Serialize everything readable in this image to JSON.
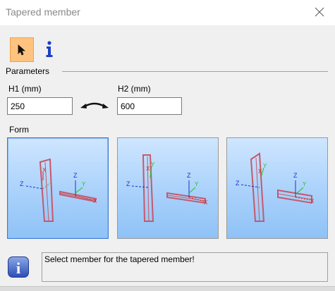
{
  "window": {
    "title": "Tapered member"
  },
  "toolbar": {
    "select_icon": "cursor-arrow-icon",
    "info_icon": "info-icon"
  },
  "parameters": {
    "group_label": "Parameters",
    "h1": {
      "label": "H1 (mm)",
      "value": "250"
    },
    "h2": {
      "label": "H2 (mm)",
      "value": "600"
    },
    "swap_icon": "swap-arrow-icon"
  },
  "form": {
    "label": "Form",
    "options": [
      {
        "name": "form-option-1",
        "selected": true
      },
      {
        "name": "form-option-2",
        "selected": false
      },
      {
        "name": "form-option-3",
        "selected": false
      }
    ],
    "axis_labels": {
      "x": "X",
      "y": "Y",
      "z": "Z"
    }
  },
  "status": {
    "message": "Select member for the tapered member!",
    "icon": "info-icon"
  },
  "colors": {
    "selected_tool": "#ffc27f",
    "info_blue": "#1a3fc8",
    "member_outline": "#c45a6a",
    "axis_x": "#e02020",
    "axis_y": "#18c818",
    "axis_z": "#1a2fd0"
  }
}
